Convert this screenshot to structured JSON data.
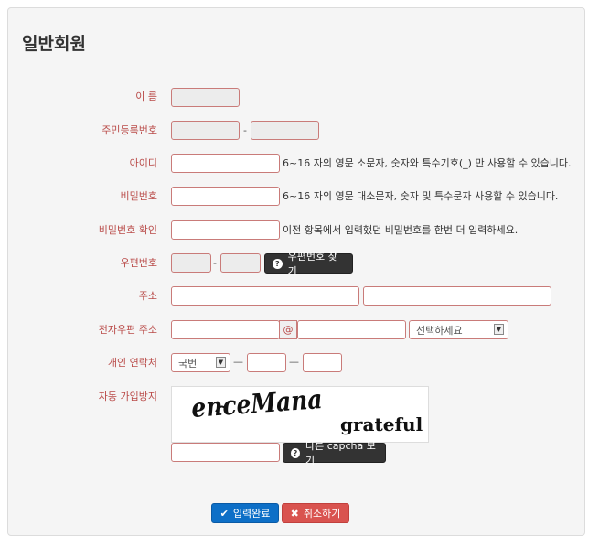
{
  "form": {
    "title": "일반회원",
    "name_label": "이 름",
    "rrn_label": "주민등록번호",
    "rrn_sep": "-",
    "id_label": "아이디",
    "id_hint": "6~16 자의 영문 소문자, 숫자와 특수기호(_) 만 사용할 수 있습니다.",
    "pw_label": "비밀번호",
    "pw_hint": "6~16 자의 영문 대소문자, 숫자 및 특수문자 사용할 수 있습니다.",
    "pw_confirm_label": "비밀번호 확인",
    "pw_confirm_hint": "이전 항목에서 입력했던 비밀번호를 한번 더 입력하세요.",
    "zip_label": "우편번호",
    "zip_sep": "-",
    "zip_button": "우편번호 찾기",
    "address_label": "주소",
    "email_label": "전자우편 주소",
    "email_at": "@",
    "email_select": "선택하세요",
    "phone_label": "개인 연락처",
    "phone_select": "국번",
    "phone_sep": "—",
    "captcha_label": "자동 가입방지",
    "captcha_word1": "enceMana",
    "captcha_word2": "grateful",
    "captcha_button": "다른 capcha 보기",
    "submit_button": "입력완료",
    "cancel_button": "취소하기"
  },
  "icons": {
    "help": "question-circle-icon",
    "check": "check-icon",
    "cancel": "times-icon"
  },
  "colors": {
    "label": "#b94a48",
    "submit": "#0d6fc7",
    "cancel": "#d9534f",
    "dark_button": "#333333"
  }
}
